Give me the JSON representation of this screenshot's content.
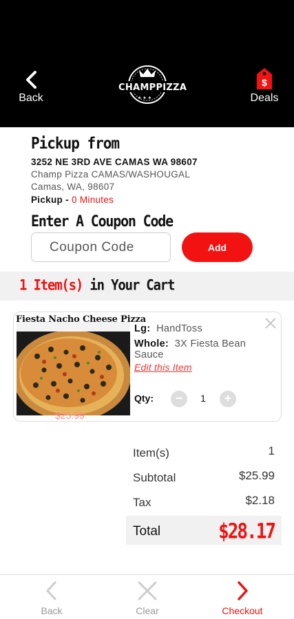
{
  "header": {
    "back_label": "Back",
    "logo_text": "CHAMPPIZZA",
    "deals_label": "Deals",
    "deals_icon_glyph": "$"
  },
  "pickup": {
    "title": "Pickup from",
    "address": "3252 NE 3RD AVE CAMAS WA 98607",
    "store_name": "Champ Pizza CAMAS/WASHOUGAL",
    "store_city": "Camas, WA, 98607",
    "method_label": "Pickup",
    "separator": " - ",
    "time": "0 Minutes"
  },
  "coupon": {
    "title": "Enter A Coupon Code",
    "placeholder": "Coupon Code",
    "value": "",
    "add_label": "Add"
  },
  "cart": {
    "count_text": "1 Item(s)",
    "suffix_text": " in Your Cart"
  },
  "items": [
    {
      "name": "Fiesta Nacho Cheese Pizza",
      "price": "$25.99",
      "size_label": "Lg:",
      "size_value": "HandToss",
      "option_label": "Whole:",
      "option_value": "3X Fiesta Bean Sauce",
      "edit_label": "Edit this Item",
      "qty_label": "Qty:",
      "qty_value": "1",
      "minus_glyph": "−",
      "plus_glyph": "+"
    }
  ],
  "totals": {
    "items_label": "Item(s)",
    "items_value": "1",
    "subtotal_label": "Subtotal",
    "subtotal_value": "$25.99",
    "tax_label": "Tax",
    "tax_value": "$2.18",
    "total_label": "Total",
    "total_value": "$28.17"
  },
  "footer": {
    "back_label": "Back",
    "clear_label": "Clear",
    "checkout_label": "Checkout"
  },
  "colors": {
    "accent_red": "#f21212",
    "header_bg": "#000000",
    "muted_gray": "#999999"
  },
  "icons": {
    "header_back": "chevron-left-icon",
    "deals": "price-tag-icon",
    "close": "close-icon",
    "footer_back": "chevron-left-icon",
    "footer_clear": "x-icon",
    "footer_checkout": "chevron-right-icon"
  }
}
